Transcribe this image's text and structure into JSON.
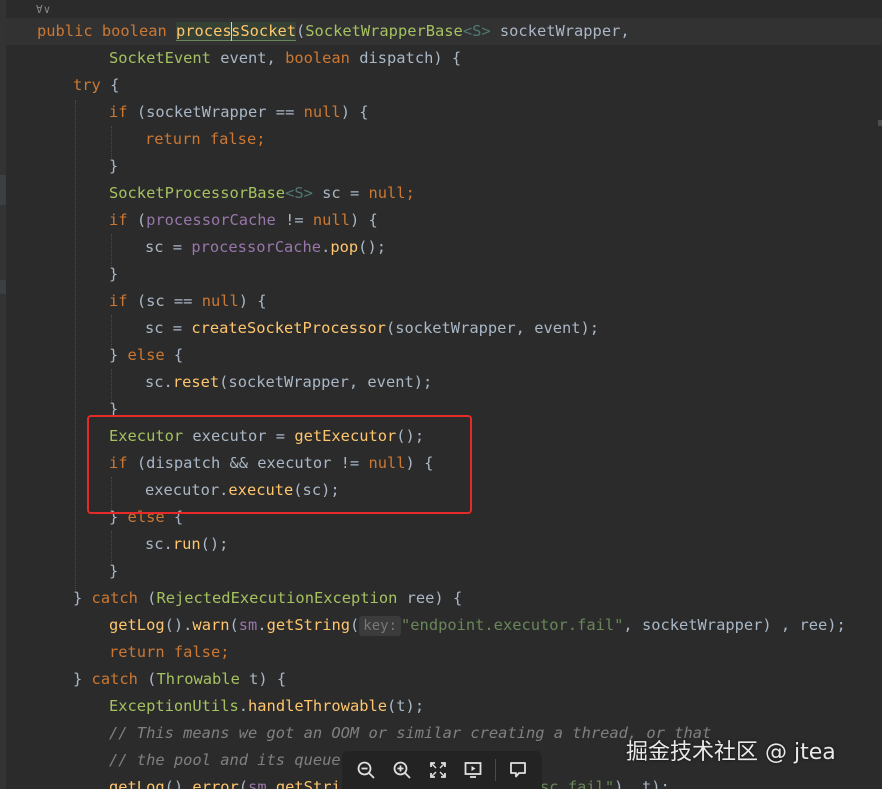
{
  "editor": {
    "fold_label": "∀∨",
    "hint_label": "key:",
    "code": {
      "l0_kw1": "public ",
      "l0_kw2": "boolean ",
      "l0_m1": "proces",
      "l0_m2": "sSocket",
      "l0_p": "(",
      "l0_t": "SocketWrapperBase",
      "l0_g": "<S>",
      "l0_rest": " socketWrapper,",
      "l1_t": "SocketEvent",
      "l1_a": " event, ",
      "l1_kw": "boolean",
      "l1_b": " dispatch) {",
      "l2_kw": "try",
      "l2_b": " {",
      "l3_kw": "if",
      "l3_a": " (socketWrapper == ",
      "l3_kw2": "null",
      "l3_b": ") {",
      "l4_kw": "return ",
      "l4_kw2": "false",
      "l4_b": ";",
      "l5": "}",
      "l6_t": "SocketProcessorBase",
      "l6_g": "<S>",
      "l6_a": " sc = ",
      "l6_kw": "null",
      "l6_b": ";",
      "l7_kw": "if",
      "l7_a": " (",
      "l7_f": "processorCache",
      "l7_b": " != ",
      "l7_kw2": "null",
      "l7_c": ") {",
      "l8_a": "sc = ",
      "l8_f": "processorCache",
      "l8_b": ".",
      "l8_m": "pop",
      "l8_c": "();",
      "l9": "}",
      "l10_kw": "if",
      "l10_a": " (sc == ",
      "l10_kw2": "null",
      "l10_b": ") {",
      "l11_a": "sc = ",
      "l11_m": "createSocketProcessor",
      "l11_b": "(socketWrapper, event);",
      "l12_a": "} ",
      "l12_kw": "else",
      "l12_b": " {",
      "l13_a": "sc.",
      "l13_m": "reset",
      "l13_b": "(socketWrapper, event);",
      "l14": "}",
      "l15_t": "Executor",
      "l15_a": " executor = ",
      "l15_m": "getExecutor",
      "l15_b": "();",
      "l16_kw": "if",
      "l16_a": " (dispatch && executor != ",
      "l16_kw2": "null",
      "l16_b": ") {",
      "l17_a": "executor.",
      "l17_m": "execute",
      "l17_b": "(sc);",
      "l18_a": "} ",
      "l18_kw": "else",
      "l18_b": " {",
      "l19_a": "sc.",
      "l19_m": "run",
      "l19_b": "();",
      "l20": "}",
      "l21_a": "} ",
      "l21_kw": "catch",
      "l21_b": " (",
      "l21_t": "RejectedExecutionException",
      "l21_c": " ree) {",
      "l22_m": "getLog",
      "l22_a": "().",
      "l22_m2": "warn",
      "l22_b": "(",
      "l22_f": "sm",
      "l22_c": ".",
      "l22_m3": "getString",
      "l22_d": "(",
      "l22_s": "\"endpoint.executor.fail\"",
      "l22_e": ", socketWrapper) , ree);",
      "l23_kw": "return ",
      "l23_kw2": "false",
      "l23_b": ";",
      "l24_a": "} ",
      "l24_kw": "catch",
      "l24_b": " (",
      "l24_t": "Throwable",
      "l24_c": " t) {",
      "l25_t": "ExceptionUtils",
      "l25_a": ".",
      "l25_m": "handleThrowable",
      "l25_b": "(t);",
      "l26": "// This means we got an OOM or similar creating a thread, or that",
      "l27": "// the pool and its queue",
      "l28_m": "getLog",
      "l28_a": "().",
      "l28_m2": "error",
      "l28_b": "(",
      "l28_f": "sm",
      "l28_c": ".",
      "l28_m3": "getStrin",
      "l28_s": "sc.fail\"",
      "l28_e": "), t);"
    }
  },
  "viewer_toolbar": {
    "zoom_out_icon": "zoom-out-icon",
    "zoom_in_icon": "zoom-in-icon",
    "fit_icon": "fullscreen-icon",
    "present_icon": "present-icon",
    "comment_icon": "comment-icon"
  },
  "watermark": {
    "text": "掘金技术社区 @ jtea"
  },
  "colors": {
    "background": "#2b2b2b",
    "keyword": "#cc7832",
    "method": "#ffc66d",
    "field": "#9876aa",
    "string": "#6a8759",
    "comment": "#808080",
    "highlight_box": "#e62a2a"
  }
}
